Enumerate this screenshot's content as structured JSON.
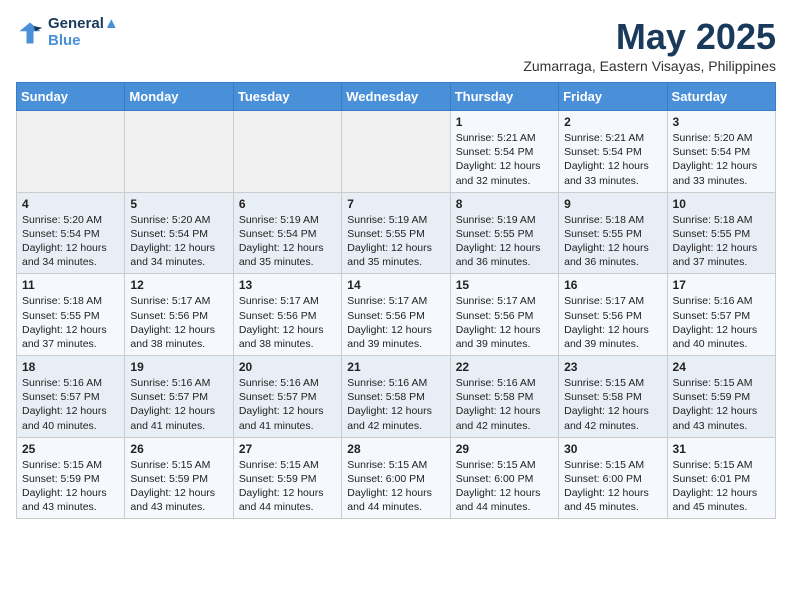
{
  "header": {
    "logo_line1": "General",
    "logo_line2": "Blue",
    "month": "May 2025",
    "location": "Zumarraga, Eastern Visayas, Philippines"
  },
  "days_of_week": [
    "Sunday",
    "Monday",
    "Tuesday",
    "Wednesday",
    "Thursday",
    "Friday",
    "Saturday"
  ],
  "weeks": [
    [
      {
        "day": "",
        "content": ""
      },
      {
        "day": "",
        "content": ""
      },
      {
        "day": "",
        "content": ""
      },
      {
        "day": "",
        "content": ""
      },
      {
        "day": "1",
        "content": "Sunrise: 5:21 AM\nSunset: 5:54 PM\nDaylight: 12 hours\nand 32 minutes."
      },
      {
        "day": "2",
        "content": "Sunrise: 5:21 AM\nSunset: 5:54 PM\nDaylight: 12 hours\nand 33 minutes."
      },
      {
        "day": "3",
        "content": "Sunrise: 5:20 AM\nSunset: 5:54 PM\nDaylight: 12 hours\nand 33 minutes."
      }
    ],
    [
      {
        "day": "4",
        "content": "Sunrise: 5:20 AM\nSunset: 5:54 PM\nDaylight: 12 hours\nand 34 minutes."
      },
      {
        "day": "5",
        "content": "Sunrise: 5:20 AM\nSunset: 5:54 PM\nDaylight: 12 hours\nand 34 minutes."
      },
      {
        "day": "6",
        "content": "Sunrise: 5:19 AM\nSunset: 5:54 PM\nDaylight: 12 hours\nand 35 minutes."
      },
      {
        "day": "7",
        "content": "Sunrise: 5:19 AM\nSunset: 5:55 PM\nDaylight: 12 hours\nand 35 minutes."
      },
      {
        "day": "8",
        "content": "Sunrise: 5:19 AM\nSunset: 5:55 PM\nDaylight: 12 hours\nand 36 minutes."
      },
      {
        "day": "9",
        "content": "Sunrise: 5:18 AM\nSunset: 5:55 PM\nDaylight: 12 hours\nand 36 minutes."
      },
      {
        "day": "10",
        "content": "Sunrise: 5:18 AM\nSunset: 5:55 PM\nDaylight: 12 hours\nand 37 minutes."
      }
    ],
    [
      {
        "day": "11",
        "content": "Sunrise: 5:18 AM\nSunset: 5:55 PM\nDaylight: 12 hours\nand 37 minutes."
      },
      {
        "day": "12",
        "content": "Sunrise: 5:17 AM\nSunset: 5:56 PM\nDaylight: 12 hours\nand 38 minutes."
      },
      {
        "day": "13",
        "content": "Sunrise: 5:17 AM\nSunset: 5:56 PM\nDaylight: 12 hours\nand 38 minutes."
      },
      {
        "day": "14",
        "content": "Sunrise: 5:17 AM\nSunset: 5:56 PM\nDaylight: 12 hours\nand 39 minutes."
      },
      {
        "day": "15",
        "content": "Sunrise: 5:17 AM\nSunset: 5:56 PM\nDaylight: 12 hours\nand 39 minutes."
      },
      {
        "day": "16",
        "content": "Sunrise: 5:17 AM\nSunset: 5:56 PM\nDaylight: 12 hours\nand 39 minutes."
      },
      {
        "day": "17",
        "content": "Sunrise: 5:16 AM\nSunset: 5:57 PM\nDaylight: 12 hours\nand 40 minutes."
      }
    ],
    [
      {
        "day": "18",
        "content": "Sunrise: 5:16 AM\nSunset: 5:57 PM\nDaylight: 12 hours\nand 40 minutes."
      },
      {
        "day": "19",
        "content": "Sunrise: 5:16 AM\nSunset: 5:57 PM\nDaylight: 12 hours\nand 41 minutes."
      },
      {
        "day": "20",
        "content": "Sunrise: 5:16 AM\nSunset: 5:57 PM\nDaylight: 12 hours\nand 41 minutes."
      },
      {
        "day": "21",
        "content": "Sunrise: 5:16 AM\nSunset: 5:58 PM\nDaylight: 12 hours\nand 42 minutes."
      },
      {
        "day": "22",
        "content": "Sunrise: 5:16 AM\nSunset: 5:58 PM\nDaylight: 12 hours\nand 42 minutes."
      },
      {
        "day": "23",
        "content": "Sunrise: 5:15 AM\nSunset: 5:58 PM\nDaylight: 12 hours\nand 42 minutes."
      },
      {
        "day": "24",
        "content": "Sunrise: 5:15 AM\nSunset: 5:59 PM\nDaylight: 12 hours\nand 43 minutes."
      }
    ],
    [
      {
        "day": "25",
        "content": "Sunrise: 5:15 AM\nSunset: 5:59 PM\nDaylight: 12 hours\nand 43 minutes."
      },
      {
        "day": "26",
        "content": "Sunrise: 5:15 AM\nSunset: 5:59 PM\nDaylight: 12 hours\nand 43 minutes."
      },
      {
        "day": "27",
        "content": "Sunrise: 5:15 AM\nSunset: 5:59 PM\nDaylight: 12 hours\nand 44 minutes."
      },
      {
        "day": "28",
        "content": "Sunrise: 5:15 AM\nSunset: 6:00 PM\nDaylight: 12 hours\nand 44 minutes."
      },
      {
        "day": "29",
        "content": "Sunrise: 5:15 AM\nSunset: 6:00 PM\nDaylight: 12 hours\nand 44 minutes."
      },
      {
        "day": "30",
        "content": "Sunrise: 5:15 AM\nSunset: 6:00 PM\nDaylight: 12 hours\nand 45 minutes."
      },
      {
        "day": "31",
        "content": "Sunrise: 5:15 AM\nSunset: 6:01 PM\nDaylight: 12 hours\nand 45 minutes."
      }
    ]
  ]
}
